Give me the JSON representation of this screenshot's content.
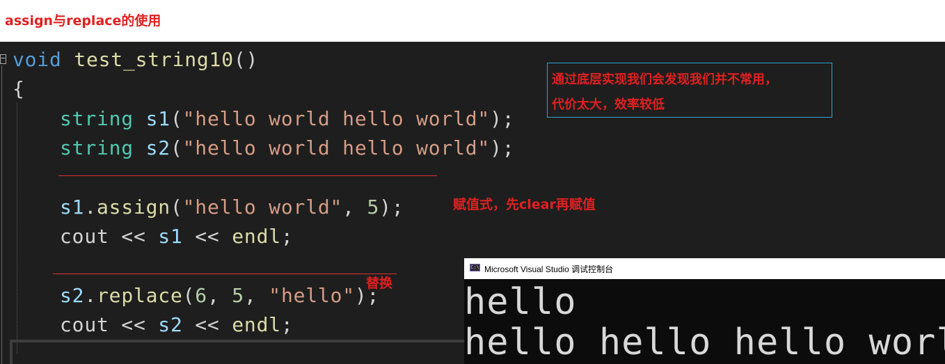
{
  "heading": "assign与replace的使用",
  "code": {
    "collapse_symbol": "−",
    "line1": {
      "kw": "void",
      "fn": "test_string10",
      "tail": "()"
    },
    "line2": {
      "brace": "{"
    },
    "line3": {
      "type": "string",
      "var": "s1",
      "open": "(",
      "str": "\"hello world hello world\"",
      "close": ");"
    },
    "line4": {
      "type": "string",
      "var": "s2",
      "open": "(",
      "str": "\"hello world hello world\"",
      "close": ");"
    },
    "line5": {
      "var": "s1",
      "dot": ".",
      "fn": "assign",
      "open": "(",
      "str": "\"hello world\"",
      "comma": ", ",
      "num": "5",
      "close": ");"
    },
    "line6": {
      "obj": "cout",
      "op1": " << ",
      "var": "s1",
      "op2": " << ",
      "fn": "endl",
      "end": ";"
    },
    "line7": {
      "var": "s2",
      "dot": ".",
      "fn": "replace",
      "open": "(",
      "num1": "6",
      "comma1": ", ",
      "num2": "5",
      "comma2": ", ",
      "str": "\"hello\"",
      "close": ");"
    },
    "line8": {
      "obj": "cout",
      "op1": " << ",
      "var": "s2",
      "op2": " << ",
      "fn": "endl",
      "end": ";"
    }
  },
  "notes": {
    "box_line1": "通过底层实现我们会发现我们并不常用，",
    "box_line2": "代价太大，效率较低",
    "assign_note": "赋值式，先clear再赋值",
    "replace_note": "替换"
  },
  "console": {
    "icon_text": "C:\\",
    "title": "Microsoft Visual Studio 调试控制台",
    "output": [
      "hello",
      "hello hello hello world"
    ]
  },
  "colors": {
    "editor_bg": "#1e1e1e",
    "keyword": "#569cd6",
    "function": "#dcdcaa",
    "type": "#4ec9b0",
    "variable": "#9cdcfe",
    "string": "#d69d85",
    "number": "#b5cea8",
    "annotation_red": "#e02020"
  }
}
